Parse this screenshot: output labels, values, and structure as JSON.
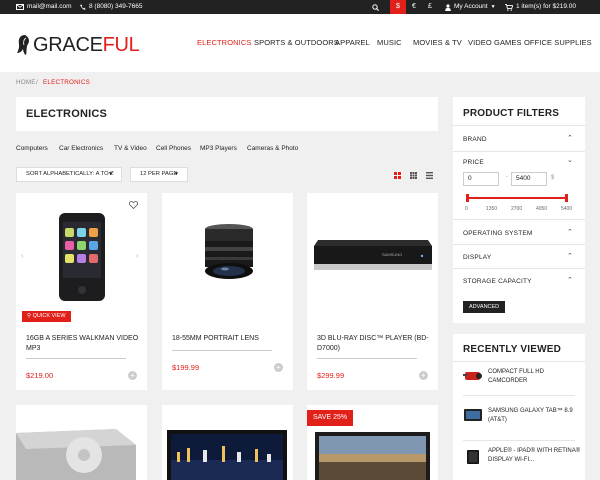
{
  "topbar": {
    "email": "mail@mail.com",
    "phone": "8 (8080) 349-7665",
    "currencies": [
      "$",
      "€",
      "£"
    ],
    "account": "My Account",
    "cart": "1 item(s) for $219.00"
  },
  "logo": {
    "part_a": "GRACE",
    "part_b": "FUL"
  },
  "nav": [
    "ELECTRONICS",
    "SPORTS & OUTDOORS",
    "APPAREL",
    "MUSIC",
    "MOVIES & TV",
    "VIDEO GAMES",
    "OFFICE SUPPLIES"
  ],
  "breadcrumb": {
    "home": "HOME",
    "sep": "/",
    "current": "ELECTRONICS"
  },
  "page_title": "ELECTRONICS",
  "subcategories": [
    "Computers",
    "Car Electronics",
    "TV & Video",
    "Cell Phones",
    "MP3 Players",
    "Cameras & Photo"
  ],
  "sort": {
    "label": "SORT ALPHABETICALLY: A TO Z",
    "per_page": "12 PER PAGE"
  },
  "products": [
    {
      "name": "16GB A SERIES WALKMAN VIDEO MP3",
      "price": "$219.00",
      "quick_view": "QUICK VIEW"
    },
    {
      "name": "18-55MM PORTRAIT LENS",
      "price": "$199.99"
    },
    {
      "name": "3D BLU-RAY DISC™ PLAYER (BD-D7000)",
      "price": "$299.99"
    }
  ],
  "sale_badge": "SAVE 25%",
  "filters": {
    "title": "PRODUCT FILTERS",
    "brand": "BRAND",
    "price": "PRICE",
    "price_min": "0",
    "price_max": "5400",
    "range_dash": "-",
    "currency": "$",
    "scale": [
      "0",
      "1350",
      "2700",
      "4050",
      "5400"
    ],
    "os": "OPERATING SYSTEM",
    "display": "DISPLAY",
    "storage": "STORAGE CAPACITY",
    "advanced": "ADVANCED"
  },
  "recently_viewed": {
    "title": "RECENTLY VIEWED",
    "items": [
      "COMPACT FULL HD CAMCORDER",
      "SAMSUNG GALAXY TAB™ 8.9 (AT&T)",
      "APPLE® - IPAD® WITH RETINA® DISPLAY WI-FI..."
    ]
  },
  "colors": {
    "accent": "#e2201a",
    "dark": "#222222",
    "bg": "#f0f0f0"
  }
}
